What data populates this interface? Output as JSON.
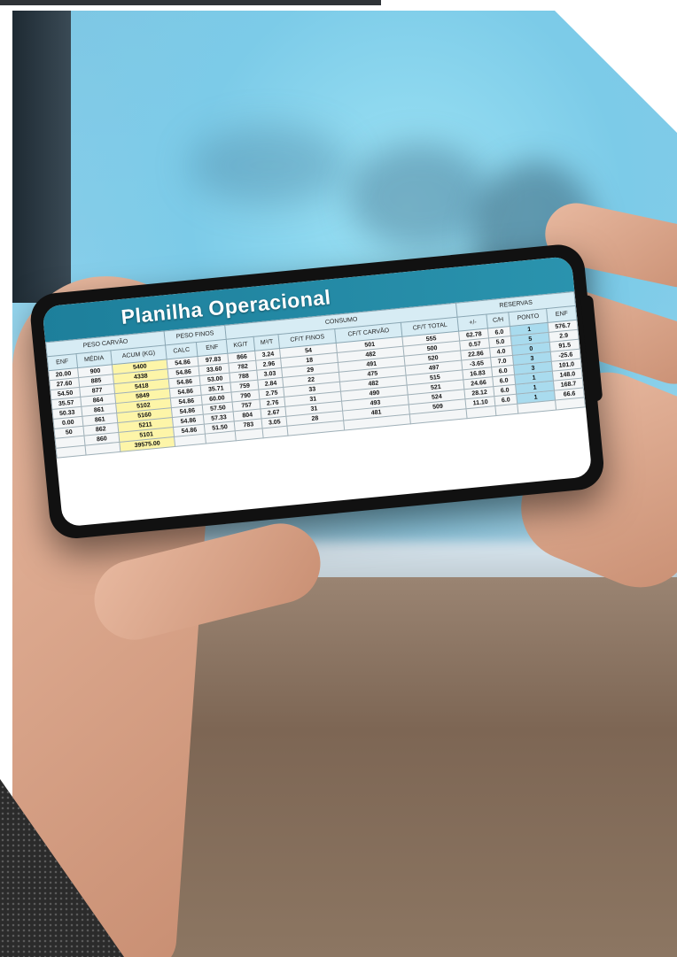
{
  "sheet": {
    "title": "Planilha Operacional",
    "group_headers": [
      "PESO CARVÃO",
      "PESO FINOS",
      "CONSUMO",
      "RESERVAS"
    ],
    "columns": [
      "ENF",
      "MÉDIA",
      "ACUM (KG)",
      "CALC",
      "ENF",
      "KG/T",
      "M³/T",
      "CF/T FINOS",
      "CF/T CARVÃO",
      "CF/T TOTAL",
      "+/-",
      "C/H",
      "PONTO",
      "ENF"
    ],
    "rows": [
      [
        "20.00",
        "900",
        "5400",
        "54.86",
        "97.83",
        "866",
        "3.24",
        "54",
        "501",
        "555",
        "62.78",
        "6.0",
        "1",
        "576.7"
      ],
      [
        "27.60",
        "885",
        "4338",
        "54.86",
        "33.60",
        "782",
        "2.96",
        "18",
        "482",
        "500",
        "0.57",
        "5.0",
        "5",
        "2.9"
      ],
      [
        "54.50",
        "877",
        "5418",
        "54.86",
        "53.00",
        "788",
        "3.03",
        "29",
        "491",
        "520",
        "22.86",
        "4.0",
        "0",
        "91.5"
      ],
      [
        "35.57",
        "864",
        "5849",
        "54.86",
        "35.71",
        "759",
        "2.84",
        "22",
        "475",
        "497",
        "-3.65",
        "7.0",
        "3",
        "-25.6"
      ],
      [
        "50.33",
        "861",
        "5102",
        "54.86",
        "60.00",
        "790",
        "2.75",
        "33",
        "482",
        "515",
        "16.83",
        "6.0",
        "3",
        "101.0"
      ],
      [
        "0.00",
        "861",
        "5160",
        "54.86",
        "57.50",
        "757",
        "2.76",
        "31",
        "490",
        "521",
        "24.66",
        "6.0",
        "1",
        "148.0"
      ],
      [
        "50",
        "862",
        "5211",
        "54.86",
        "57.33",
        "804",
        "2.67",
        "31",
        "493",
        "524",
        "28.12",
        "6.0",
        "1",
        "168.7"
      ],
      [
        "",
        "860",
        "5101",
        "54.86",
        "51.50",
        "783",
        "3.05",
        "28",
        "481",
        "509",
        "11.10",
        "6.0",
        "1",
        "66.6"
      ]
    ],
    "total": "39575.00"
  }
}
